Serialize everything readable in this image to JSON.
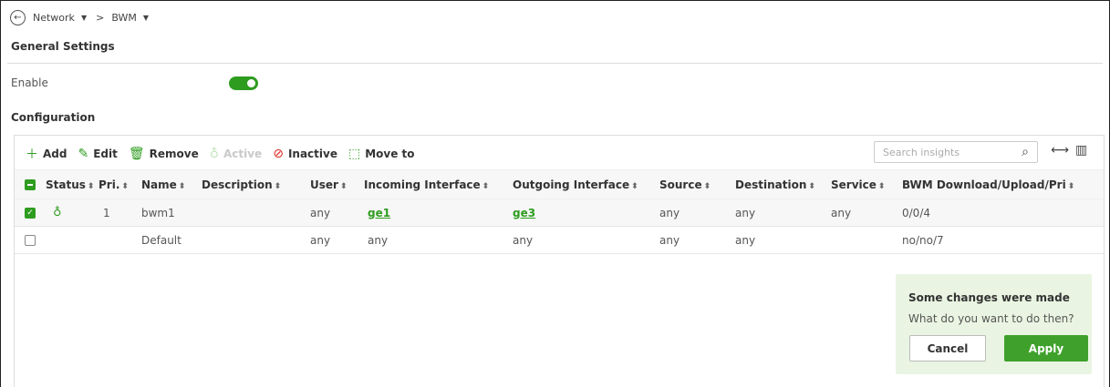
{
  "breadcrumb": {
    "back_icon": "arrow-left-circle-icon",
    "items": [
      "Network",
      "BWM"
    ],
    "separator": ">"
  },
  "general_settings": {
    "title": "General Settings",
    "enable_label": "Enable",
    "enable_on": true
  },
  "configuration": {
    "title": "Configuration",
    "toolbar": {
      "add": "Add",
      "edit": "Edit",
      "remove": "Remove",
      "active": "Active",
      "inactive": "Inactive",
      "move_to": "Move to"
    },
    "search_placeholder": "Search insights",
    "columns": [
      "Status",
      "Pri.",
      "Name",
      "Description",
      "User",
      "Incoming Interface",
      "Outgoing Interface",
      "Source",
      "Destination",
      "Service",
      "BWM Download/Upload/Pri"
    ],
    "rows": [
      {
        "checked": true,
        "status": "active",
        "pri": "1",
        "name": "bwm1",
        "description": "",
        "user": "any",
        "incoming": "ge1",
        "outgoing": "ge3",
        "source": "any",
        "destination": "any",
        "service": "any",
        "bwm": "0/0/4"
      },
      {
        "checked": false,
        "status": "",
        "pri": "",
        "name": "Default",
        "description": "",
        "user": "any",
        "incoming": "any",
        "outgoing": "any",
        "source": "any",
        "destination": "any",
        "service": "",
        "bwm": "no/no/7"
      }
    ]
  },
  "notice": {
    "title": "Some changes were made",
    "subtitle": "What do you want to do then?",
    "cancel": "Cancel",
    "apply": "Apply"
  },
  "colors": {
    "accent": "#2e9c1f",
    "notice_bg": "#e9f5e2",
    "inactive_icon": "#d9261c"
  }
}
